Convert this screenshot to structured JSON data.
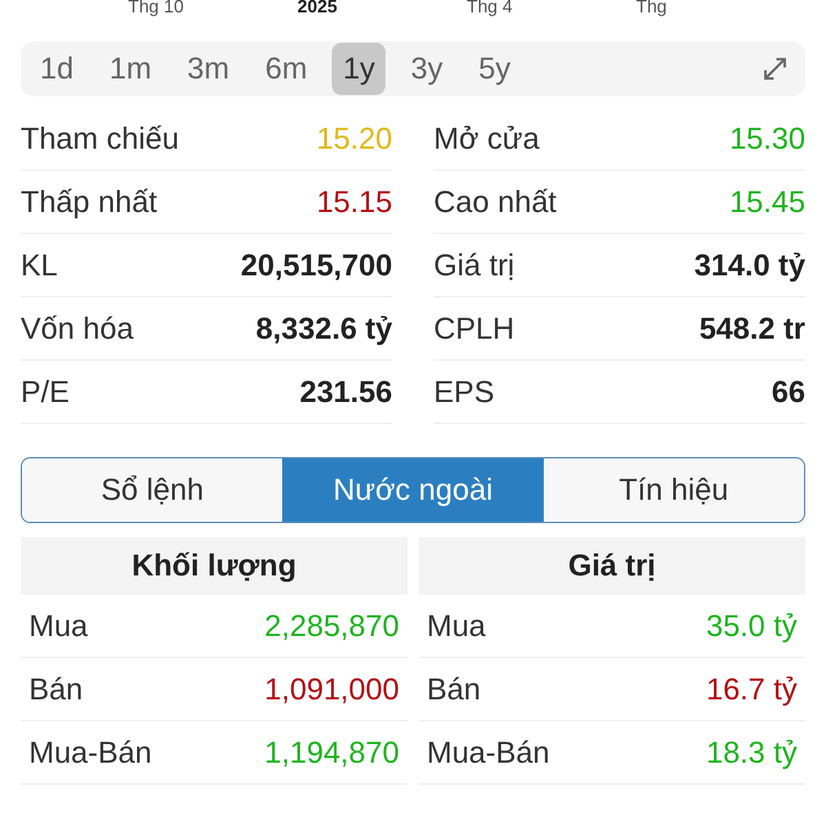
{
  "axis_labels": [
    {
      "text": "Thg 10",
      "kind": "month"
    },
    {
      "text": "2025",
      "kind": "year"
    },
    {
      "text": "Thg 4",
      "kind": "month"
    },
    {
      "text": "Thg",
      "kind": "month"
    }
  ],
  "ranges": [
    {
      "label": "1d",
      "selected": false
    },
    {
      "label": "1m",
      "selected": false
    },
    {
      "label": "3m",
      "selected": false
    },
    {
      "label": "6m",
      "selected": false
    },
    {
      "label": "1y",
      "selected": true
    },
    {
      "label": "3y",
      "selected": false
    },
    {
      "label": "5y",
      "selected": false
    }
  ],
  "stats": [
    {
      "label": "Tham chiếu",
      "value": "15.20",
      "kind": "price",
      "color": "#e0b818"
    },
    {
      "label": "Mở cửa",
      "value": "15.30",
      "kind": "price",
      "color": "#1eb41e"
    },
    {
      "label": "Thấp nhất",
      "value": "15.15",
      "kind": "price",
      "color": "#b40f14"
    },
    {
      "label": "Cao nhất",
      "value": "15.45",
      "kind": "price",
      "color": "#1eb41e"
    },
    {
      "label": "KL",
      "value": "20,515,700",
      "kind": "figure",
      "color": "#222222"
    },
    {
      "label": "Giá trị",
      "value": "314.0 tỷ",
      "kind": "figure",
      "color": "#222222"
    },
    {
      "label": "Vốn hóa",
      "value": "8,332.6 tỷ",
      "kind": "figure",
      "color": "#222222"
    },
    {
      "label": "CPLH",
      "value": "548.2 tr",
      "kind": "figure",
      "color": "#222222"
    },
    {
      "label": "P/E",
      "value": "231.56",
      "kind": "figure",
      "color": "#222222"
    },
    {
      "label": "EPS",
      "value": "66",
      "kind": "figure",
      "color": "#222222"
    }
  ],
  "tabs": [
    {
      "label": "Sổ lệnh",
      "selected": false
    },
    {
      "label": "Nước ngoài",
      "selected": true
    },
    {
      "label": "Tín hiệu",
      "selected": false
    }
  ],
  "foreign": [
    {
      "title": "Khối lượng",
      "rows": [
        {
          "label": "Mua",
          "value": "2,285,870",
          "color": "#1eb41e"
        },
        {
          "label": "Bán",
          "value": "1,091,000",
          "color": "#b40f14"
        },
        {
          "label": "Mua-Bán",
          "value": "1,194,870",
          "color": "#1eb41e"
        }
      ]
    },
    {
      "title": "Giá trị",
      "rows": [
        {
          "label": "Mua",
          "value": "35.0 tỷ",
          "color": "#1eb41e"
        },
        {
          "label": "Bán",
          "value": "16.7 tỷ",
          "color": "#b40f14"
        },
        {
          "label": "Mua-Bán",
          "value": "18.3 tỷ",
          "color": "#1eb41e"
        }
      ]
    }
  ]
}
